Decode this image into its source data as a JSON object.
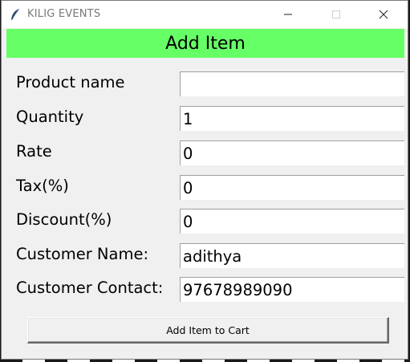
{
  "window": {
    "title": "KILIG EVENTS",
    "icon": "feather-icon",
    "controls": [
      "minimize-icon",
      "maximize-icon",
      "close-icon"
    ]
  },
  "header": {
    "title": "Add Item",
    "color": "#66ff66"
  },
  "form": {
    "fields": [
      {
        "label": "Product name",
        "value": ""
      },
      {
        "label": "Quantity",
        "value": "1"
      },
      {
        "label": "Rate",
        "value": "0"
      },
      {
        "label": "Tax(%)",
        "value": "0"
      },
      {
        "label": "Discount(%)",
        "value": "0"
      },
      {
        "label": "Customer Name:",
        "value": "adithya"
      },
      {
        "label": "Customer Contact:",
        "value": "97678989090"
      }
    ]
  },
  "actions": {
    "add_label": "Add Item to Cart"
  }
}
